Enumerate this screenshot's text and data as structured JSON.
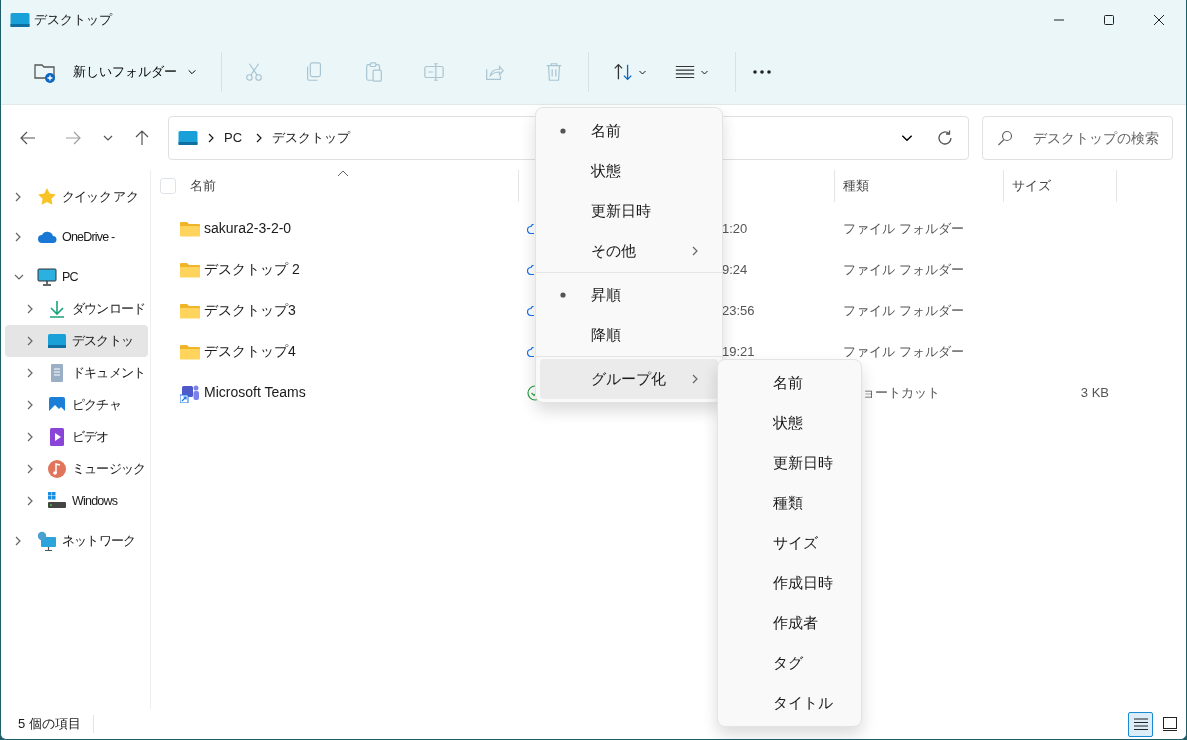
{
  "window": {
    "title": "デスクトップ"
  },
  "toolbar": {
    "new_button": {
      "label": "新しいフォルダー"
    },
    "actions": [
      {
        "kind": "cut",
        "disabled": true
      },
      {
        "kind": "copy",
        "disabled": true
      },
      {
        "kind": "paste",
        "disabled": true
      },
      {
        "kind": "rename",
        "disabled": true
      },
      {
        "kind": "share",
        "disabled": true
      },
      {
        "kind": "delete",
        "disabled": true
      }
    ],
    "menus": [
      {
        "kind": "sort"
      },
      {
        "kind": "view"
      }
    ]
  },
  "navigation": {
    "back": {
      "disabled": false
    },
    "forward": {
      "disabled": true
    }
  },
  "address": {
    "segments": [
      "PC",
      "デスクトップ"
    ]
  },
  "search": {
    "placeholder": "デスクトップの検索"
  },
  "sidebar": {
    "items": [
      {
        "kind": "quick",
        "label": "クイック アク",
        "expanded": false,
        "selected": false
      },
      {
        "kind": "onedrive",
        "label": "OneDrive -",
        "expanded": false,
        "selected": false
      },
      {
        "kind": "pc",
        "label": "PC",
        "expanded": true,
        "selected": false,
        "children": [
          {
            "kind": "downloads",
            "label": "ダウンロード",
            "expanded": false,
            "selected": false
          },
          {
            "kind": "desktop",
            "label": "デスクトッ",
            "expanded": false,
            "selected": true
          },
          {
            "kind": "documents",
            "label": "ドキュメント",
            "expanded": false,
            "selected": false
          },
          {
            "kind": "pictures",
            "label": "ピクチャ",
            "expanded": false,
            "selected": false
          },
          {
            "kind": "videos",
            "label": "ビデオ",
            "expanded": false,
            "selected": false
          },
          {
            "kind": "music",
            "label": "ミュージック",
            "expanded": false,
            "selected": false
          },
          {
            "kind": "drive",
            "label": "Windows",
            "expanded": false,
            "selected": false
          }
        ]
      },
      {
        "kind": "network",
        "label": "ネットワーク",
        "expanded": false,
        "selected": false
      }
    ]
  },
  "table": {
    "select_all": {
      "checked": false
    },
    "columns": [
      {
        "label": "名前",
        "sorted": true
      },
      {
        "label": "種類",
        "sorted": false
      },
      {
        "label": "サイズ",
        "sorted": false
      }
    ],
    "rows": [
      {
        "kind": "folder",
        "name": "sakura2-3-2-0",
        "available_offline": false,
        "modified": "1:20",
        "type": "ファイル フォルダー"
      },
      {
        "kind": "folder",
        "name": "デスクトップ 2",
        "available_offline": false,
        "modified": "9:24",
        "type": "ファイル フォルダー"
      },
      {
        "kind": "folder",
        "name": "デスクトップ3",
        "available_offline": false,
        "modified": "23:56",
        "type": "ファイル フォルダー"
      },
      {
        "kind": "folder",
        "name": "デスクトップ4",
        "available_offline": false,
        "modified": "19:21",
        "type": "ファイル フォルダー"
      },
      {
        "kind": "shortcut",
        "name": "Microsoft Teams",
        "available_offline": true,
        "type": "ョートカット",
        "size": "3 KB"
      }
    ]
  },
  "sort_menu": {
    "items": [
      {
        "kind": "option",
        "label": "名前",
        "selected": true
      },
      {
        "kind": "option",
        "label": "状態",
        "selected": false
      },
      {
        "kind": "option",
        "label": "更新日時",
        "selected": false
      },
      {
        "kind": "submenu",
        "label": "その他",
        "highlighted": false
      },
      {
        "kind": "separator"
      },
      {
        "kind": "option",
        "label": "昇順",
        "selected": true
      },
      {
        "kind": "option",
        "label": "降順",
        "selected": false
      },
      {
        "kind": "separator"
      },
      {
        "kind": "submenu",
        "label": "グループ化",
        "highlighted": true
      }
    ]
  },
  "group_menu": {
    "items": [
      "名前",
      "状態",
      "更新日時",
      "種類",
      "サイズ",
      "作成日時",
      "作成者",
      "タグ",
      "タイトル"
    ]
  },
  "status_bar": {
    "count": "5 個の項目",
    "views": [
      {
        "kind": "details",
        "selected": true
      },
      {
        "kind": "tiles",
        "selected": false
      }
    ]
  }
}
